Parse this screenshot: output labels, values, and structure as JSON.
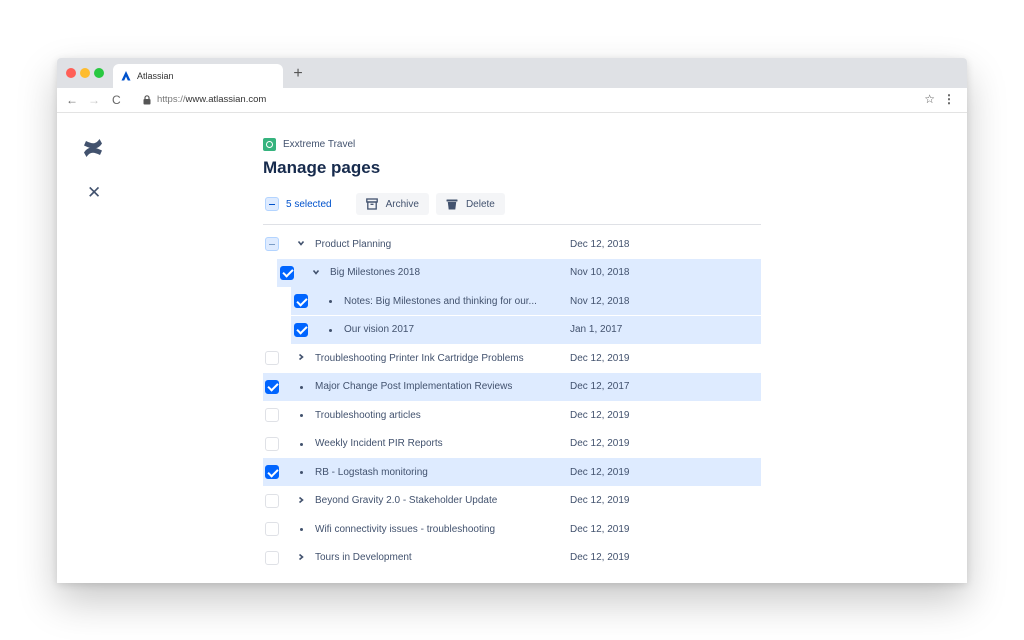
{
  "browser": {
    "tab_title": "Atlassian",
    "new_tab": "+",
    "url_scheme": "https://",
    "url_host": "www.atlassian.com",
    "back": "←",
    "forward": "→",
    "reload": "C",
    "star": "☆",
    "menu": "⋮"
  },
  "sidebar": {
    "close": "✕"
  },
  "page": {
    "space_name": "Exxtreme Travel",
    "title": "Manage pages",
    "selected_label": "5 selected",
    "archive_label": "Archive",
    "delete_label": "Delete"
  },
  "rows": [
    {
      "label": "Product Planning",
      "date": "Dec 12, 2018",
      "state": "partial",
      "marker": "chevron-down",
      "depth": 0
    },
    {
      "label": "Big Milestones 2018",
      "date": "Nov 10, 2018",
      "state": "checked",
      "marker": "chevron-down",
      "depth": 1
    },
    {
      "label": "Notes: Big Milestones and thinking for our...",
      "date": "Nov 12, 2018",
      "state": "checked",
      "marker": "bullet",
      "depth": 2
    },
    {
      "label": "Our vision 2017",
      "date": "Jan 1, 2017",
      "state": "checked",
      "marker": "bullet",
      "depth": 2
    },
    {
      "label": "Troubleshooting Printer Ink Cartridge Problems",
      "date": "Dec 12, 2019",
      "state": "unchecked",
      "marker": "chevron-right",
      "depth": 0
    },
    {
      "label": "Major Change Post Implementation Reviews",
      "date": "Dec 12, 2017",
      "state": "checked",
      "marker": "bullet",
      "depth": 0
    },
    {
      "label": "Troubleshooting articles",
      "date": "Dec 12, 2019",
      "state": "unchecked",
      "marker": "bullet",
      "depth": 0
    },
    {
      "label": "Weekly Incident PIR Reports",
      "date": "Dec 12, 2019",
      "state": "unchecked",
      "marker": "bullet",
      "depth": 0
    },
    {
      "label": "RB - Logstash monitoring",
      "date": "Dec 12, 2019",
      "state": "checked",
      "marker": "bullet",
      "depth": 0
    },
    {
      "label": "Beyond Gravity 2.0 - Stakeholder Update",
      "date": "Dec 12, 2019",
      "state": "unchecked",
      "marker": "chevron-right",
      "depth": 0
    },
    {
      "label": "Wifi connectivity issues - troubleshooting",
      "date": "Dec 12, 2019",
      "state": "unchecked",
      "marker": "bullet",
      "depth": 0
    },
    {
      "label": "Tours in Development",
      "date": "Dec 12, 2019",
      "state": "unchecked",
      "marker": "chevron-right",
      "depth": 0
    }
  ],
  "colors": {
    "selected_row": "#deebff",
    "checkbox_checked": "#0065ff",
    "link": "#0052cc",
    "heading": "#172b4d"
  }
}
